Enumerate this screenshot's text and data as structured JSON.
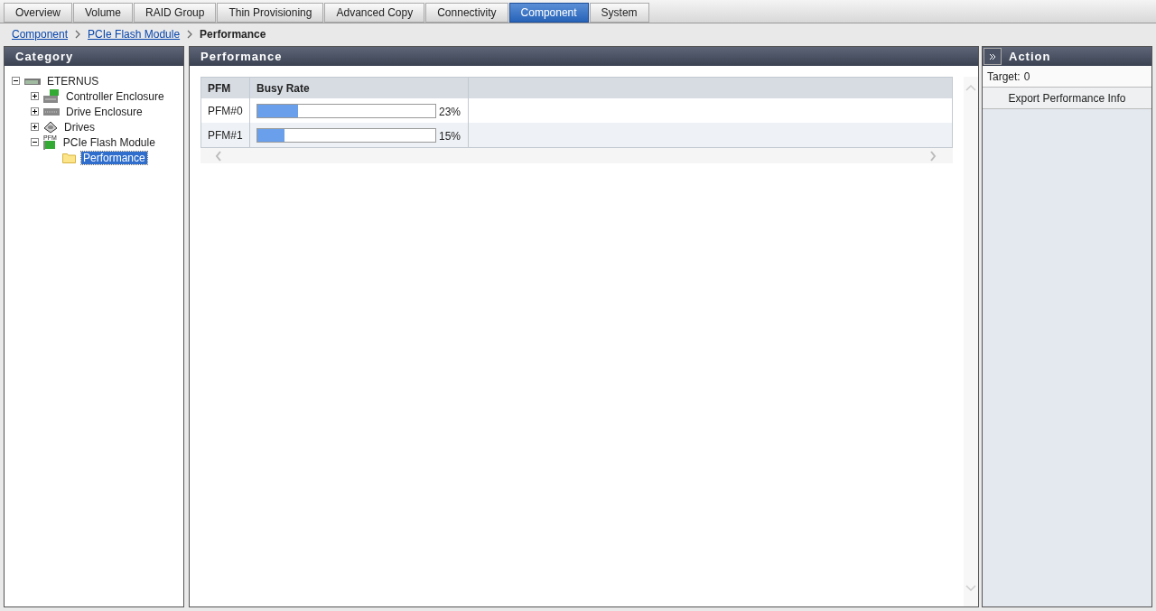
{
  "tabs": [
    {
      "label": "Overview",
      "selected": false
    },
    {
      "label": "Volume",
      "selected": false
    },
    {
      "label": "RAID Group",
      "selected": false
    },
    {
      "label": "Thin Provisioning",
      "selected": false
    },
    {
      "label": "Advanced Copy",
      "selected": false
    },
    {
      "label": "Connectivity",
      "selected": false
    },
    {
      "label": "Component",
      "selected": true
    },
    {
      "label": "System",
      "selected": false
    }
  ],
  "breadcrumb": {
    "links": [
      "Component",
      "PCIe Flash Module"
    ],
    "current": "Performance"
  },
  "category": {
    "title": "Category",
    "tree": [
      {
        "label": "ETERNUS",
        "kind": "storage",
        "expanded": true,
        "selected": false,
        "children": [
          {
            "label": "Controller Enclosure",
            "kind": "controller",
            "expanded": false,
            "selected": false
          },
          {
            "label": "Drive Enclosure",
            "kind": "enclosure",
            "expanded": false,
            "selected": false
          },
          {
            "label": "Drives",
            "kind": "drive",
            "expanded": false,
            "selected": false
          },
          {
            "label": "PCIe Flash Module",
            "kind": "pcie",
            "icon_text": "PFM",
            "expanded": true,
            "selected": false,
            "children": [
              {
                "label": "Performance",
                "kind": "folder",
                "selected": true
              }
            ]
          }
        ]
      }
    ]
  },
  "performance": {
    "title": "Performance",
    "columns": [
      "PFM",
      "Busy Rate"
    ],
    "rows": [
      {
        "pfm": "PFM#0",
        "level": 0.23,
        "reading": "23%"
      },
      {
        "pfm": "PFM#1",
        "level": 0.15,
        "reading": "15%"
      }
    ]
  },
  "action": {
    "title": "Action",
    "target_label": "Target:",
    "target_value": "0",
    "buttons": [
      "Export Performance Info"
    ]
  }
}
